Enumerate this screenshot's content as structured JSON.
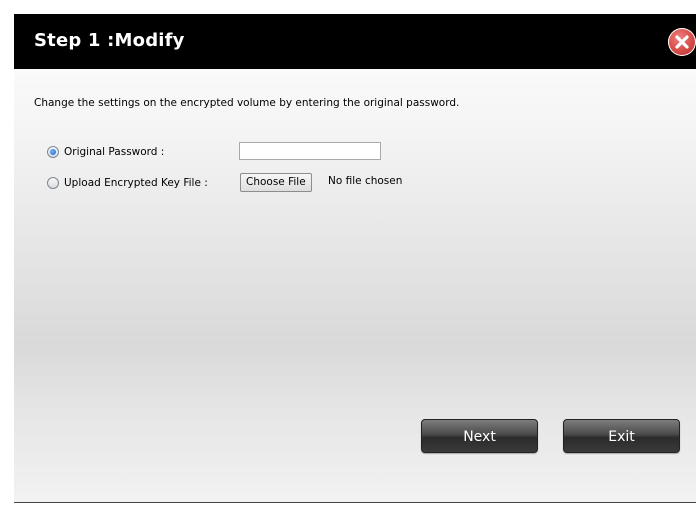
{
  "dialog": {
    "title": "Step 1 :Modify",
    "close_icon": "close-x-icon",
    "description": "Change the settings on the encrypted volume by entering the original password.",
    "options": [
      {
        "label": "Original Password :",
        "selected": true
      },
      {
        "label": "Upload Encrypted Key File :",
        "selected": false
      }
    ],
    "password_value": "",
    "file": {
      "button_label": "Choose File",
      "status": "No file chosen"
    },
    "buttons": {
      "next": "Next",
      "exit": "Exit"
    },
    "colors": {
      "titlebar": "#000000",
      "close": "#d9534f",
      "button": "#3a3a3a"
    }
  }
}
